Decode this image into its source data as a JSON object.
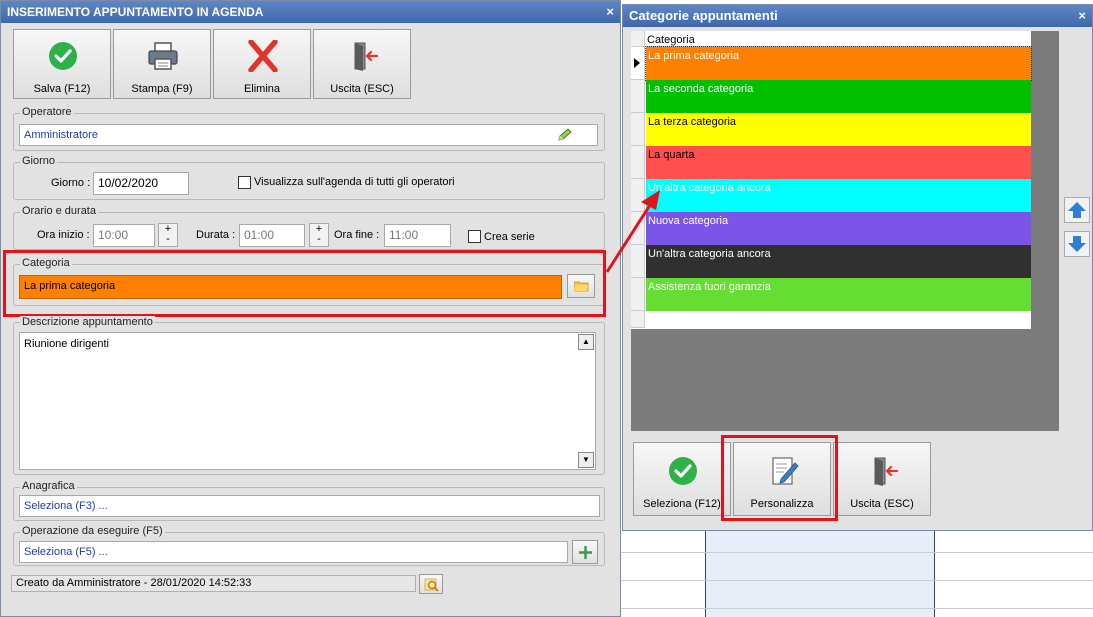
{
  "colors": {
    "accent_red": "#e0141c",
    "title_bar": "#4a74b9",
    "field_text_blue": "#1f3bb0"
  },
  "dialog1": {
    "title": "INSERIMENTO APPUNTAMENTO IN AGENDA",
    "close": "×",
    "toolbar": {
      "save": "Salva (F12)",
      "print": "Stampa (F9)",
      "delete": "Elimina",
      "exit": "Uscita (ESC)"
    },
    "operatore": {
      "group": "Operatore",
      "value": "Amministratore"
    },
    "giorno": {
      "group": "Giorno",
      "label": "Giorno :",
      "value": "10/02/2020",
      "checkbox": "Visualizza sull'agenda di tutti gli operatori"
    },
    "orario": {
      "group": "Orario e durata",
      "start_label": "Ora inizio :",
      "start_value": "10:00",
      "duration_label": "Durata :",
      "duration_value": "01:00",
      "end_label": "Ora fine :",
      "end_value": "11:00",
      "series": "Crea serie",
      "plus": "+",
      "minus": "-"
    },
    "categoria": {
      "group": "Categoria",
      "value": "La prima categoria",
      "color": "#ff8000"
    },
    "descrizione": {
      "group": "Descrizione appuntamento",
      "value": "Riunione dirigenti"
    },
    "anagrafica": {
      "group": "Anagrafica",
      "value": "Seleziona (F3) ..."
    },
    "operazione": {
      "group": "Operazione da eseguire (F5)",
      "value": "Seleziona (F5) ..."
    },
    "status": "Creato da Amministratore - 28/01/2020 14:52:33"
  },
  "dialog2": {
    "title": "Categorie appuntamenti",
    "close": "×",
    "column_header": "Categoria",
    "rows": [
      {
        "label": "La prima categoria",
        "bg": "#ff8000",
        "fg": "#ffffff"
      },
      {
        "label": "La seconda categoria",
        "bg": "#00c000",
        "fg": "#ffffff"
      },
      {
        "label": "La terza categoria",
        "bg": "#ffff00",
        "fg": "#000000"
      },
      {
        "label": "La quarta",
        "bg": "#ff4f4f",
        "fg": "#000000"
      },
      {
        "label": "Un'altra categoria ancora",
        "bg": "#00ffff",
        "fg": "#ffffff"
      },
      {
        "label": "Nuova categoria",
        "bg": "#7b55e8",
        "fg": "#ffffff"
      },
      {
        "label": "Un'altra categoria ancora",
        "bg": "#303030",
        "fg": "#ffffff"
      },
      {
        "label": "Assistenza fuori garanzia",
        "bg": "#66dd33",
        "fg": "#ffffff"
      }
    ],
    "buttons": {
      "select": "Seleziona (F12)",
      "customize": "Personalizza",
      "exit": "Uscita (ESC)"
    }
  }
}
